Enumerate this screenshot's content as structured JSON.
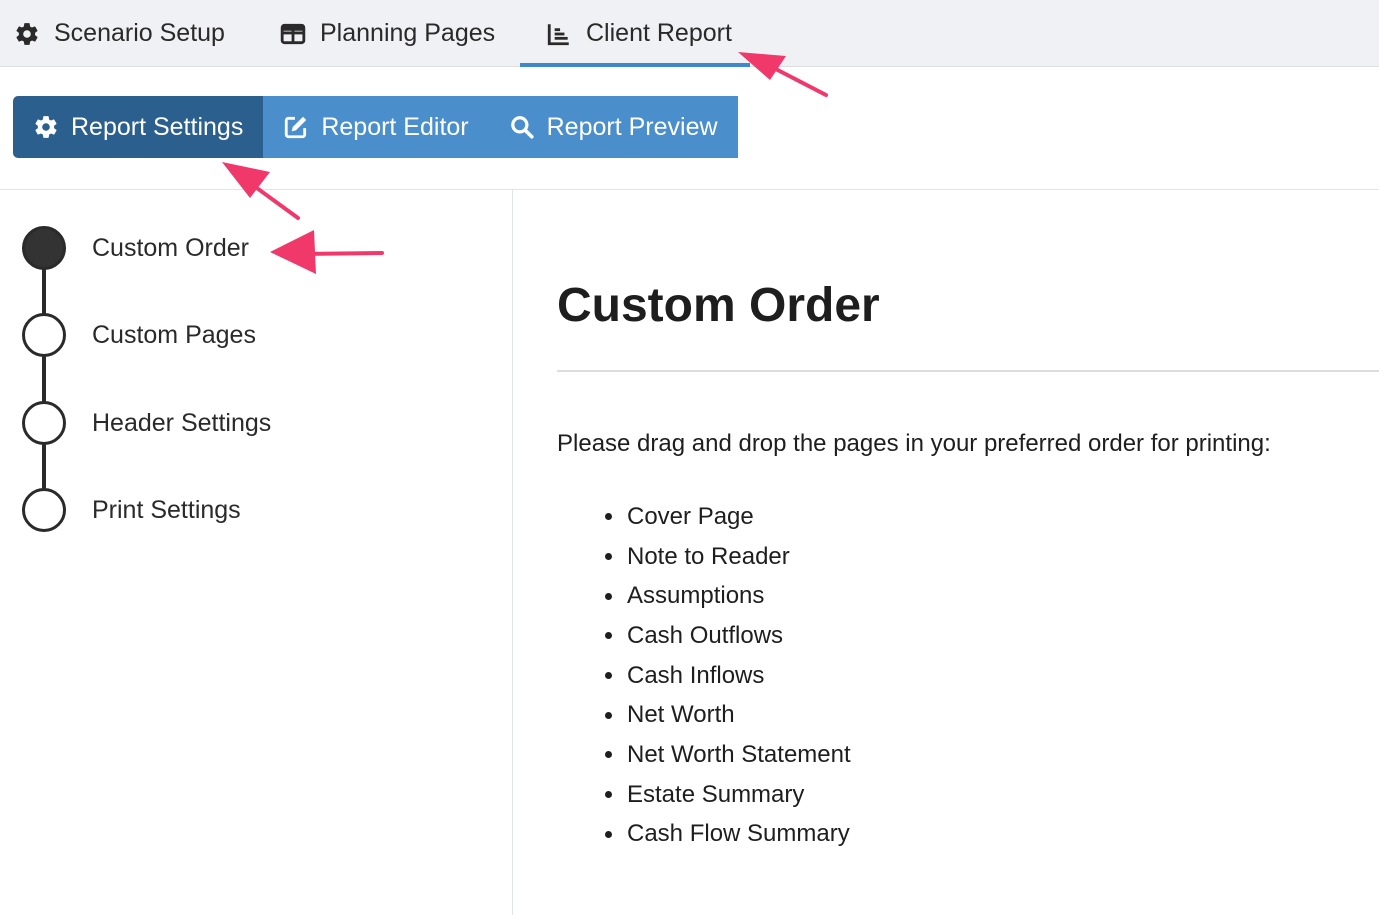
{
  "topnav": {
    "tabs": [
      {
        "label": "Scenario Setup",
        "icon": "gear-icon"
      },
      {
        "label": "Planning Pages",
        "icon": "table-icon"
      },
      {
        "label": "Client Report",
        "icon": "chart-icon",
        "active": true
      }
    ]
  },
  "report_tabs": {
    "buttons": [
      {
        "label": "Report Settings",
        "icon": "gear-icon",
        "active": true
      },
      {
        "label": "Report Editor",
        "icon": "edit-icon"
      },
      {
        "label": "Report Preview",
        "icon": "search-icon"
      }
    ]
  },
  "stepper": {
    "steps": [
      {
        "label": "Custom Order",
        "active": true
      },
      {
        "label": "Custom Pages"
      },
      {
        "label": "Header Settings"
      },
      {
        "label": "Print Settings"
      }
    ]
  },
  "content": {
    "title": "Custom Order",
    "instructions": "Please drag and drop the pages in your preferred order for printing:",
    "pages": [
      "Cover Page",
      "Note to Reader",
      "Assumptions",
      "Cash Outflows",
      "Cash Inflows",
      "Net Worth",
      "Net Worth Statement",
      "Estate Summary",
      "Cash Flow Summary"
    ]
  },
  "colors": {
    "nav_bg": "#f0f1f4",
    "active_underline": "#3f88c9",
    "button_blue": "#4a8fcc",
    "button_active": "#2b5f8e",
    "annotation_arrow": "#f0386b"
  }
}
